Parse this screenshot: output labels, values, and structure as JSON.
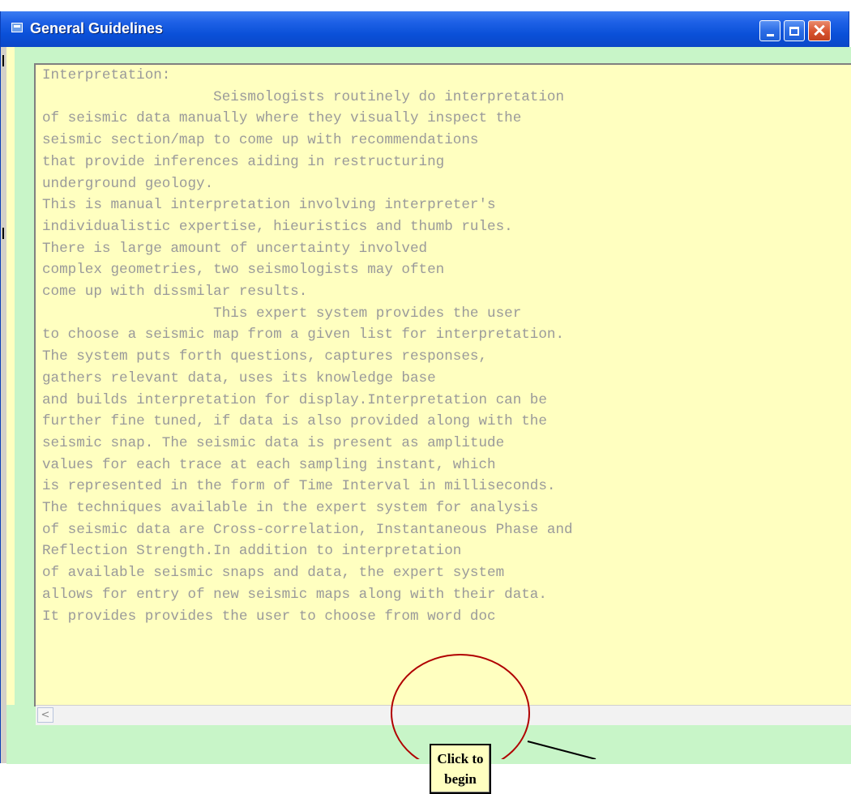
{
  "window": {
    "title": "General Guidelines",
    "icon": "window-icon",
    "controls": [
      "minimize-icon",
      "maximize-icon",
      "close-icon"
    ],
    "close_glyph": "✕"
  },
  "guidelines_text": "Interpretation:\n                    Seismologists routinely do interpretation\nof seismic data manually where they visually inspect the\nseismic section/map to come up with recommendations\nthat provide inferences aiding in restructuring\nunderground geology.\nThis is manual interpretation involving interpreter's\nindividualistic expertise, hieuristics and thumb rules.\nThere is large amount of uncertainty involved\ncomplex geometries, two seismologists may often\ncome up with dissmilar results.\n                    This expert system provides the user\nto choose a seismic map from a given list for interpretation.\nThe system puts forth questions, captures responses,\ngathers relevant data, uses its knowledge base\nand builds interpretation for display.Interpretation can be\nfurther fine tuned, if data is also provided along with the\nseismic snap. The seismic data is present as amplitude\nvalues for each trace at each sampling instant, which\nis represented in the form of Time Interval in milliseconds.\nThe techniques available in the expert system for analysis\nof seismic data are Cross-correlation, Instantaneous Phase and\nReflection Strength.In addition to interpretation\nof available seismic snaps and data, the expert system\nallows for entry of new seismic maps along with their data.\nIt provides provides the user to choose from word doc",
  "begin_button": {
    "label": "Click to\nbegin"
  },
  "scrollbar": {
    "left_arrow": "<"
  },
  "colors": {
    "titlebar": "#0a50d8",
    "text_background": "#ffffc0",
    "form_background": "#c8f5c8",
    "text_color": "#9a9a9a",
    "highlight_circle": "#b00000"
  }
}
